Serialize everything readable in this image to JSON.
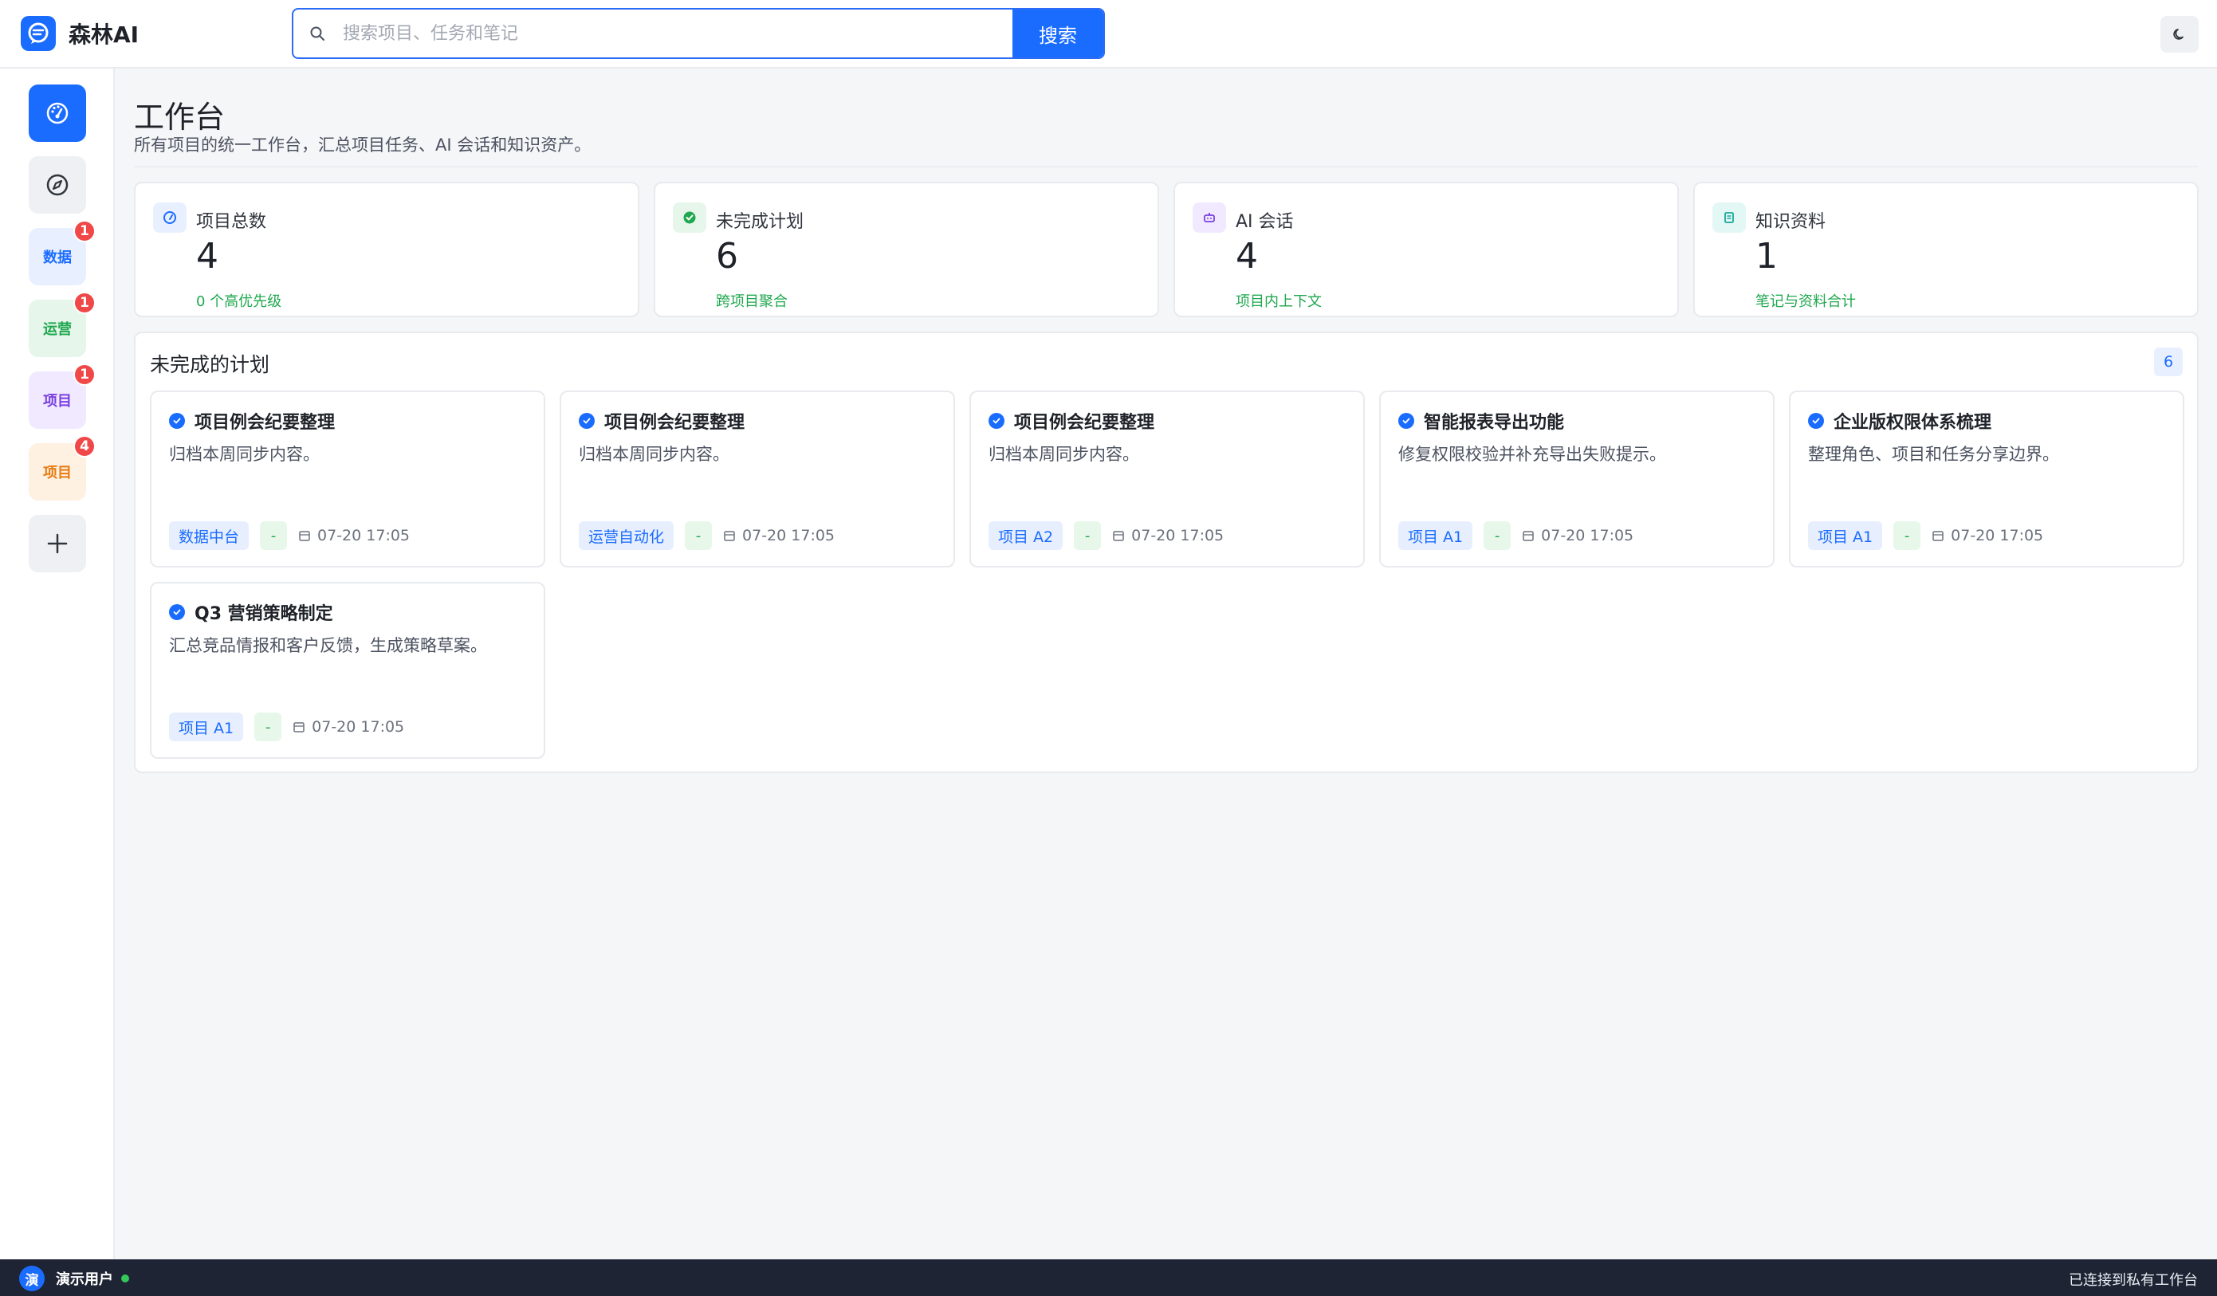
{
  "app": {
    "name": "森林AI"
  },
  "search": {
    "placeholder": "搜索项目、任务和笔记",
    "button_label": "搜索"
  },
  "sidebar": {
    "items": [
      {
        "name": "dashboard",
        "label": "",
        "icon": "dashboard-icon",
        "active": true
      },
      {
        "name": "explore",
        "label": "",
        "icon": "compass-icon"
      },
      {
        "name": "data",
        "label": "数据",
        "badge": "1",
        "color": "#1a6cff",
        "bg": "#e8f0ff"
      },
      {
        "name": "ops",
        "label": "运营",
        "badge": "1",
        "color": "#1fa84f",
        "bg": "#e6f6ea"
      },
      {
        "name": "project-purple",
        "label": "项目",
        "badge": "1",
        "color": "#7a3fe0",
        "bg": "#f0e9ff"
      },
      {
        "name": "project-orange",
        "label": "项目",
        "badge": "4",
        "color": "#e77b10",
        "bg": "#fff1e2"
      },
      {
        "name": "add",
        "label": "",
        "icon": "plus-icon"
      }
    ]
  },
  "page": {
    "title": "工作台",
    "description": "所有项目的统一工作台，汇总项目任务、AI 会话和知识资产。"
  },
  "stats": [
    {
      "label": "项目总数",
      "value": "4",
      "sub": "0 个高优先级",
      "icon": "gauge-icon",
      "icon_bg": "#e8f0ff",
      "icon_color": "#1a6cff"
    },
    {
      "label": "未完成计划",
      "value": "6",
      "sub": "跨项目聚合",
      "icon": "check-circle-icon",
      "icon_bg": "#e6f6ea",
      "icon_color": "#1fa84f"
    },
    {
      "label": "AI 会话",
      "value": "4",
      "sub": "项目内上下文",
      "icon": "robot-icon",
      "icon_bg": "#f1e9ff",
      "icon_color": "#7a3fe0"
    },
    {
      "label": "知识资料",
      "value": "1",
      "sub": "笔记与资料合计",
      "icon": "document-icon",
      "icon_bg": "#e3f7f5",
      "icon_color": "#18a99b"
    }
  ],
  "plans": {
    "title": "未完成的计划",
    "count": "6",
    "tasks": [
      {
        "title": "项目例会纪要整理",
        "desc": "归档本周同步内容。",
        "project": "数据中台",
        "priority": "-",
        "date": "07-20 17:05"
      },
      {
        "title": "项目例会纪要整理",
        "desc": "归档本周同步内容。",
        "project": "运营自动化",
        "priority": "-",
        "date": "07-20 17:05"
      },
      {
        "title": "项目例会纪要整理",
        "desc": "归档本周同步内容。",
        "project": "项目 A2",
        "priority": "-",
        "date": "07-20 17:05"
      },
      {
        "title": "智能报表导出功能",
        "desc": "修复权限校验并补充导出失败提示。",
        "project": "项目 A1",
        "priority": "-",
        "date": "07-20 17:05"
      },
      {
        "title": "企业版权限体系梳理",
        "desc": "整理角色、项目和任务分享边界。",
        "project": "项目 A1",
        "priority": "-",
        "date": "07-20 17:05"
      },
      {
        "title": "Q3 营销策略制定",
        "desc": "汇总竞品情报和客户反馈，生成策略草案。",
        "project": "项目 A1",
        "priority": "-",
        "date": "07-20 17:05"
      }
    ]
  },
  "footer": {
    "avatar_text": "演",
    "user_name": "演示用户",
    "status": "已连接到私有工作台"
  }
}
